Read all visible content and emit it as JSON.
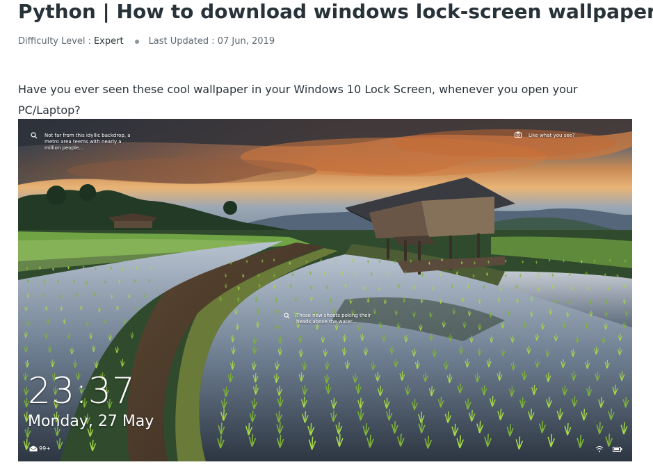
{
  "article": {
    "title": "Python | How to download windows lock-screen wallpapers",
    "meta": {
      "difficulty_label": "Difficulty Level :",
      "difficulty_value": "Expert",
      "updated_label": "Last Updated : 07 Jun, 2019"
    },
    "lead_text": "Have you ever seen these cool wallpaper in your Windows 10 Lock Screen, whenever you open your PC/Laptop?"
  },
  "lockscreen": {
    "caption_top_left": "Not far from this idyllic backdrop, a metro area teems with nearly a million people...",
    "caption_top_right": "Like what you see?",
    "caption_center": "Those new shoots poking their heads above the water...",
    "time": "23:37",
    "date": "Monday, 27 May",
    "mail_count": "99+"
  },
  "colors": {
    "text_primary": "#273239",
    "text_muted": "#5b6770"
  }
}
